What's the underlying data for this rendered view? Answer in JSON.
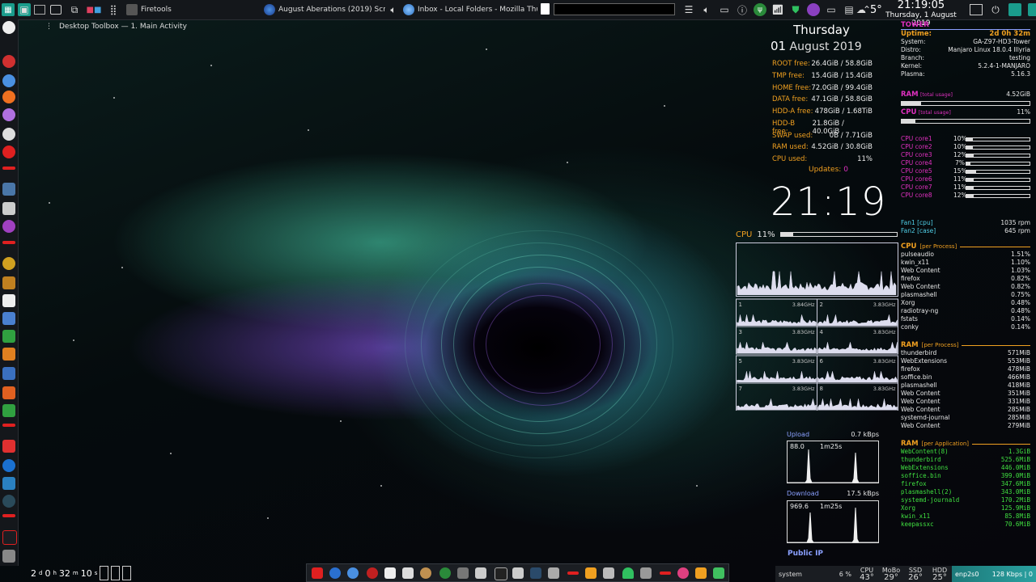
{
  "topbar": {
    "tasks": [
      {
        "label": "Firetools"
      },
      {
        "label": "August Aberations (2019) Screensh..."
      },
      {
        "label": "Inbox - Local Folders - Mozilla Thunderb..."
      }
    ],
    "clock": {
      "time": "21:19:05",
      "date": "Thursday, 1 August 2019"
    },
    "weather": {
      "temp": "5°"
    }
  },
  "toolbox": {
    "label": "Desktop Toolbox — 1. Main Activity"
  },
  "conky_left": {
    "day": "Thursday",
    "date_num": "01",
    "date_rest": "August 2019",
    "fs": [
      {
        "k": "ROOT free:",
        "v": "26.4GiB / 58.8GiB"
      },
      {
        "k": "TMP free:",
        "v": "15.4GiB / 15.4GiB"
      },
      {
        "k": "HOME free:",
        "v": "72.0GiB / 99.4GiB"
      },
      {
        "k": "DATA free:",
        "v": "47.1GiB / 58.8GiB"
      },
      {
        "k": "HDD-A free:",
        "v": "478GiB / 1.68TiB"
      },
      {
        "k": "HDD-B free:",
        "v": "21.8GiB / 40.0GiB"
      },
      {
        "k": "SWAP used:",
        "v": "0B / 7.71GiB"
      },
      {
        "k": "RAM used:",
        "v": "4.52GiB / 30.8GiB"
      },
      {
        "k": "CPU used:",
        "v": "11%"
      }
    ],
    "updates_label": "Updates:",
    "updates_count": "0",
    "big_clock": "21:19",
    "cpu_label": "CPU",
    "cpu_value": "11%",
    "cpu_fraction": 0.11,
    "cores_freq": [
      {
        "n": "1",
        "f": "3.84GHz"
      },
      {
        "n": "2",
        "f": "3.83GHz"
      },
      {
        "n": "3",
        "f": "3.83GHz"
      },
      {
        "n": "4",
        "f": "3.83GHz"
      },
      {
        "n": "5",
        "f": "3.83GHz"
      },
      {
        "n": "6",
        "f": "3.83GHz"
      },
      {
        "n": "7",
        "f": "3.83GHz"
      },
      {
        "n": "8",
        "f": "3.83GHz"
      }
    ]
  },
  "network": {
    "upload_label": "Upload",
    "upload_value": "0.7 kBps",
    "upload_max": "88.0",
    "upload_span": "1m25s",
    "download_label": "Download",
    "download_value": "17.5 kBps",
    "download_max": "969.6",
    "download_span": "1m25s",
    "public_ip_label": "Public IP"
  },
  "sysinfo": {
    "host": "TOWER",
    "uptime_label": "Uptime:",
    "uptime": "2d 0h 32m",
    "rows": [
      {
        "k": "System:",
        "v": "GA-Z97-HD3-Tower"
      },
      {
        "k": "Distro:",
        "v": "Manjaro Linux 18.0.4 Illyria"
      },
      {
        "k": "Branch:",
        "v": "testing"
      },
      {
        "k": "Kernel:",
        "v": "5.2.4-1-MANJARO"
      },
      {
        "k": "Plasma:",
        "v": "5.16.3"
      }
    ],
    "ram_label": "RAM",
    "ram_sub": "[total usage]",
    "ram_value": "4.52GiB",
    "ram_fraction": 0.15,
    "cpu_label": "CPU",
    "cpu_sub": "[total usage]",
    "cpu_value": "11%",
    "cpu_fraction": 0.11,
    "cores": [
      {
        "name": "CPU core1",
        "val": "10%",
        "frac": 0.1
      },
      {
        "name": "CPU core2",
        "val": "10%",
        "frac": 0.1
      },
      {
        "name": "CPU core3",
        "val": "12%",
        "frac": 0.12
      },
      {
        "name": "CPU core4",
        "val": "7%",
        "frac": 0.07
      },
      {
        "name": "CPU core5",
        "val": "15%",
        "frac": 0.15
      },
      {
        "name": "CPU core6",
        "val": "11%",
        "frac": 0.11
      },
      {
        "name": "CPU core7",
        "val": "11%",
        "frac": 0.11
      },
      {
        "name": "CPU core8",
        "val": "12%",
        "frac": 0.12
      }
    ],
    "fans": [
      {
        "k": "Fan1 [cpu]",
        "v": "1035 rpm"
      },
      {
        "k": "Fan2 [case]",
        "v": "645 rpm"
      }
    ]
  },
  "cpu_per_process": {
    "title": "CPU",
    "sub": "[per Process]",
    "rows": [
      {
        "k": "pulseaudio",
        "v": "1.51%"
      },
      {
        "k": "kwin_x11",
        "v": "1.10%"
      },
      {
        "k": "Web Content",
        "v": "1.03%"
      },
      {
        "k": "firefox",
        "v": "0.82%"
      },
      {
        "k": "Web Content",
        "v": "0.82%"
      },
      {
        "k": "plasmashell",
        "v": "0.75%"
      },
      {
        "k": "Xorg",
        "v": "0.48%"
      },
      {
        "k": "radiotray-ng",
        "v": "0.48%"
      },
      {
        "k": "fstats",
        "v": "0.14%"
      },
      {
        "k": "conky",
        "v": "0.14%"
      }
    ]
  },
  "ram_per_process": {
    "title": "RAM",
    "sub": "[per Process]",
    "rows": [
      {
        "k": "thunderbird",
        "v": "571MiB"
      },
      {
        "k": "WebExtensions",
        "v": "553MiB"
      },
      {
        "k": "firefox",
        "v": "478MiB"
      },
      {
        "k": "soffice.bin",
        "v": "466MiB"
      },
      {
        "k": "plasmashell",
        "v": "418MiB"
      },
      {
        "k": "Web Content",
        "v": "351MiB"
      },
      {
        "k": "Web Content",
        "v": "331MiB"
      },
      {
        "k": "Web Content",
        "v": "285MiB"
      },
      {
        "k": "systemd-journal",
        "v": "285MiB"
      },
      {
        "k": "Web Content",
        "v": "279MiB"
      }
    ]
  },
  "ram_per_app": {
    "title": "RAM",
    "sub": "[per Application]",
    "rows": [
      {
        "k": "WebContent(8)",
        "v": "1.3GiB"
      },
      {
        "k": "thunderbird",
        "v": "525.6MiB"
      },
      {
        "k": "WebExtensions",
        "v": "446.0MiB"
      },
      {
        "k": "soffice.bin",
        "v": "399.0MiB"
      },
      {
        "k": "firefox",
        "v": "347.6MiB"
      },
      {
        "k": "plasmashell(2)",
        "v": "343.0MiB"
      },
      {
        "k": "systemd-journald",
        "v": "170.2MiB"
      },
      {
        "k": "Xorg",
        "v": "125.9MiB"
      },
      {
        "k": "kwin_x11",
        "v": "85.8MiB"
      },
      {
        "k": "keepassxc",
        "v": "70.6MiB"
      }
    ]
  },
  "bottom_left": {
    "d": "2",
    "d_u": "d",
    "h": "0",
    "h_u": "h",
    "m": "32",
    "m_u": "m",
    "s": "10",
    "s_u": "s"
  },
  "sysbar": {
    "system": "system",
    "pct": "6 %",
    "cpu_label": "CPU",
    "cpu_temp": "43°",
    "mobo_label": "MoBo",
    "mobo_temp": "29°",
    "ssd_label": "SSD",
    "ssd_temp": "26°",
    "hdd_label": "HDD",
    "hdd_temp": "25°",
    "net_if": "enp2s0",
    "net_rate": "128 Kbps | 0"
  }
}
